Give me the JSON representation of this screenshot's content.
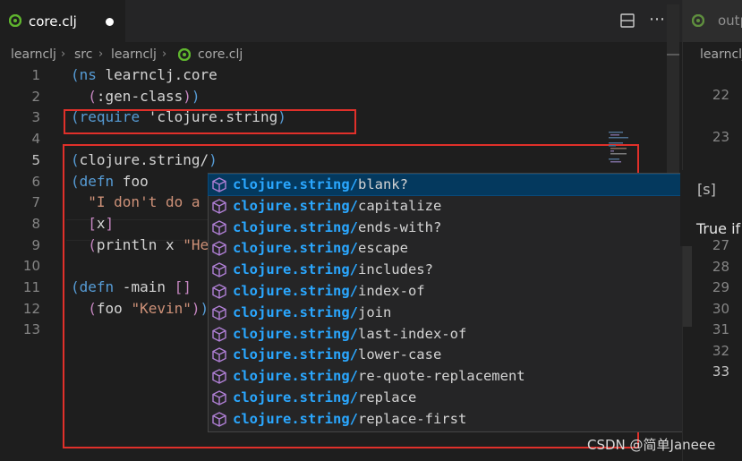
{
  "tab": {
    "filename": "core.clj"
  },
  "breadcrumb": [
    "learnclj",
    "src",
    "learnclj",
    "core.clj"
  ],
  "code": {
    "line_numbers": [
      "1",
      "2",
      "3",
      "4",
      "5",
      "6",
      "7",
      "8",
      "9",
      "10",
      "11",
      "12",
      "13"
    ],
    "current_line": "5",
    "lines": [
      [
        [
          "p1",
          "("
        ],
        [
          "kw",
          "ns"
        ],
        [
          "plain",
          " learnclj.core"
        ]
      ],
      [
        [
          "plain",
          "  "
        ],
        [
          "p2",
          "("
        ],
        [
          "plain",
          ":gen-class"
        ],
        [
          "p2",
          ")"
        ],
        [
          "p1",
          ")"
        ]
      ],
      [
        [
          "p1",
          "("
        ],
        [
          "kw",
          "require"
        ],
        [
          "plain",
          " 'clojure.string"
        ],
        [
          "p1",
          ")"
        ]
      ],
      [],
      [
        [
          "p1",
          "("
        ],
        [
          "plain",
          "clojure.string/"
        ],
        [
          "p1",
          ")"
        ]
      ],
      [
        [
          "p1",
          "("
        ],
        [
          "kw",
          "defn"
        ],
        [
          "plain",
          " foo"
        ]
      ],
      [
        [
          "plain",
          "  "
        ],
        [
          "str",
          "\"I don't do a"
        ]
      ],
      [
        [
          "plain",
          "  "
        ],
        [
          "p2",
          "["
        ],
        [
          "plain",
          "x"
        ],
        [
          "p2",
          "]"
        ]
      ],
      [
        [
          "plain",
          "  "
        ],
        [
          "p2",
          "("
        ],
        [
          "plain",
          "println x "
        ],
        [
          "str",
          "\"He"
        ]
      ],
      [],
      [
        [
          "p1",
          "("
        ],
        [
          "kw",
          "defn"
        ],
        [
          "plain",
          " -main "
        ],
        [
          "p2",
          "[]"
        ]
      ],
      [
        [
          "plain",
          "  "
        ],
        [
          "p2",
          "("
        ],
        [
          "plain",
          "foo "
        ],
        [
          "str",
          "\"Kevin\""
        ],
        [
          "p2",
          ")"
        ],
        [
          "p1",
          ")"
        ]
      ],
      []
    ]
  },
  "suggestions": {
    "namespace": "clojure.string/",
    "items": [
      "blank?",
      "capitalize",
      "ends-with?",
      "escape",
      "includes?",
      "index-of",
      "join",
      "last-index-of",
      "lower-case",
      "re-quote-replacement",
      "replace",
      "replace-first"
    ],
    "selected_index": 0
  },
  "right_panel": {
    "tab_label": "outp",
    "breadcrumb": "learnclj",
    "line_numbers_top": [
      "22",
      "23"
    ],
    "output_marker": "[s]",
    "output_text": "True if",
    "line_numbers_bottom": [
      "27",
      "28",
      "29",
      "30",
      "31",
      "32",
      "33"
    ],
    "current_line": "33"
  },
  "watermark": "CSDN @简单Janeee",
  "colors": {
    "red_highlight": "#e0302a",
    "suggest_namespace": "#2aa7ff",
    "clojure_icon_green": "#5fb52e",
    "cube_icon_purple": "#b180d7"
  }
}
